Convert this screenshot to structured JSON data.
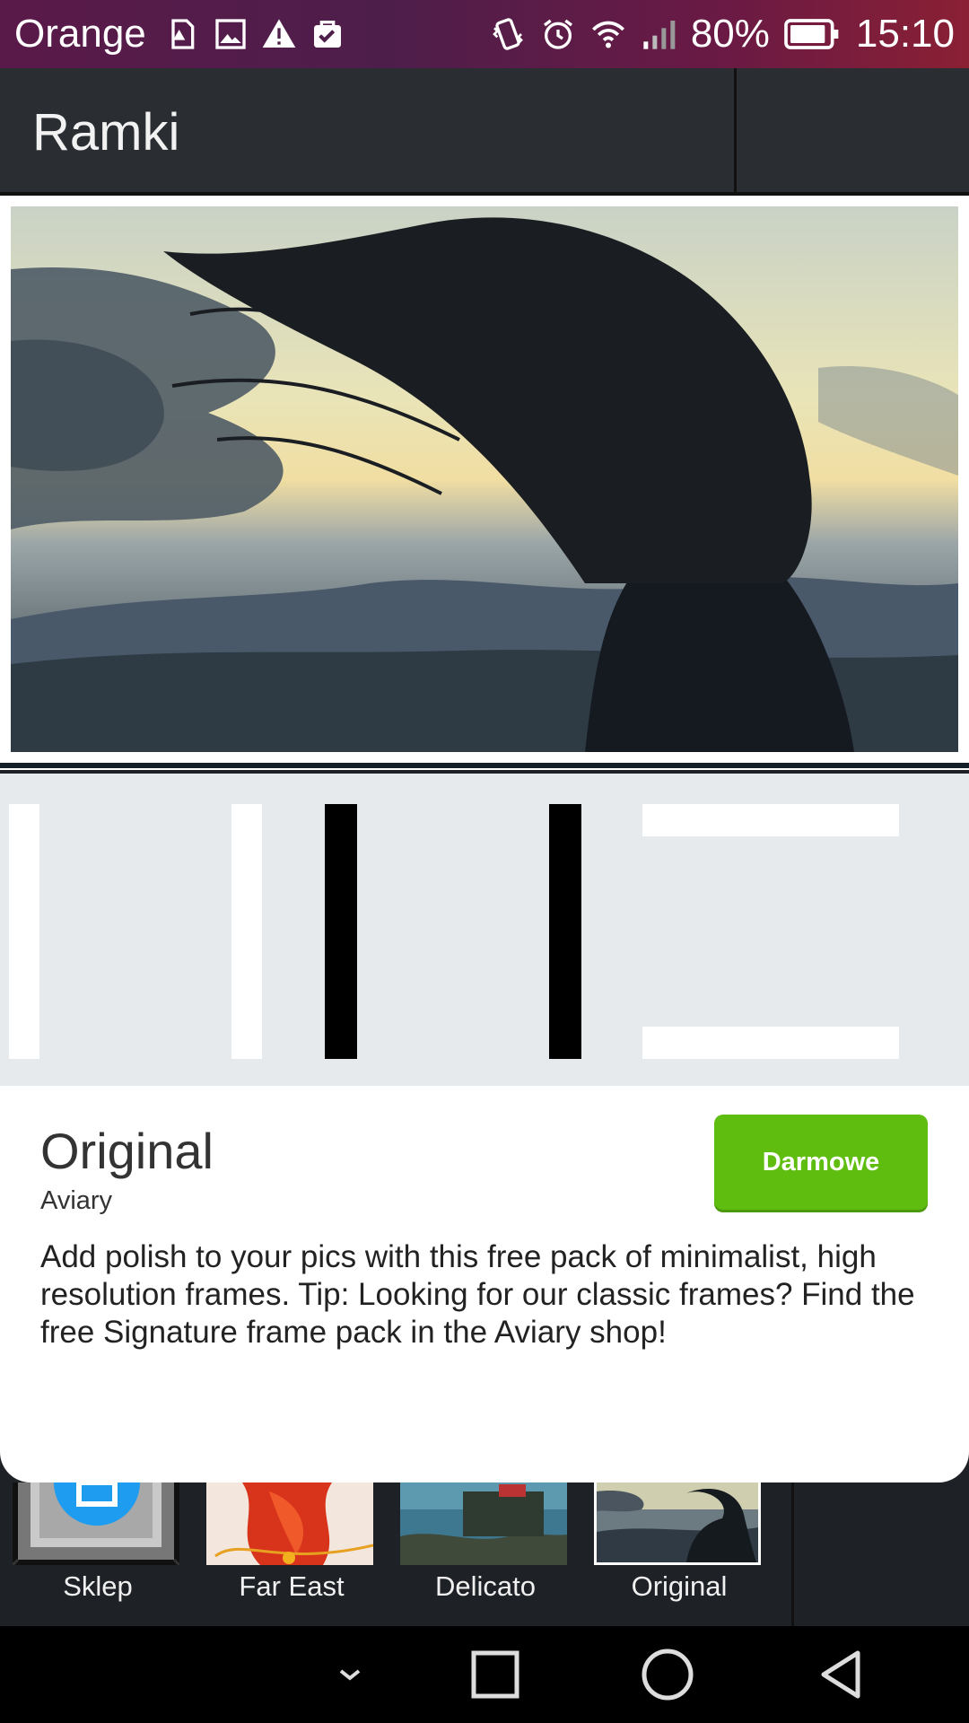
{
  "status_bar": {
    "carrier": "Orange",
    "battery": "80%",
    "time": "15:10",
    "icons_left": [
      "sim-alert-icon",
      "image-icon",
      "warning-icon",
      "bag-check-icon"
    ],
    "icons_right": [
      "vibrate-icon",
      "alarm-icon",
      "wifi-icon",
      "signal-icon",
      "battery-icon"
    ]
  },
  "header": {
    "title": "Ramki"
  },
  "pack": {
    "name": "Original",
    "author": "Aviary",
    "price_button": "Darmowe",
    "description": "Add polish to your pics with this free pack of minimalist, high resolution frames. Tip: Looking for our classic frames? Find the free Signature frame pack in the Aviary shop!"
  },
  "tray": {
    "items": [
      {
        "label": "Sklep"
      },
      {
        "label": "Far East"
      },
      {
        "label": "Delicato"
      },
      {
        "label": "Original"
      }
    ]
  },
  "colors": {
    "accent_green": "#5fbd0f",
    "store_blue": "#1e9cef",
    "status_bar": "#5a1a49"
  }
}
